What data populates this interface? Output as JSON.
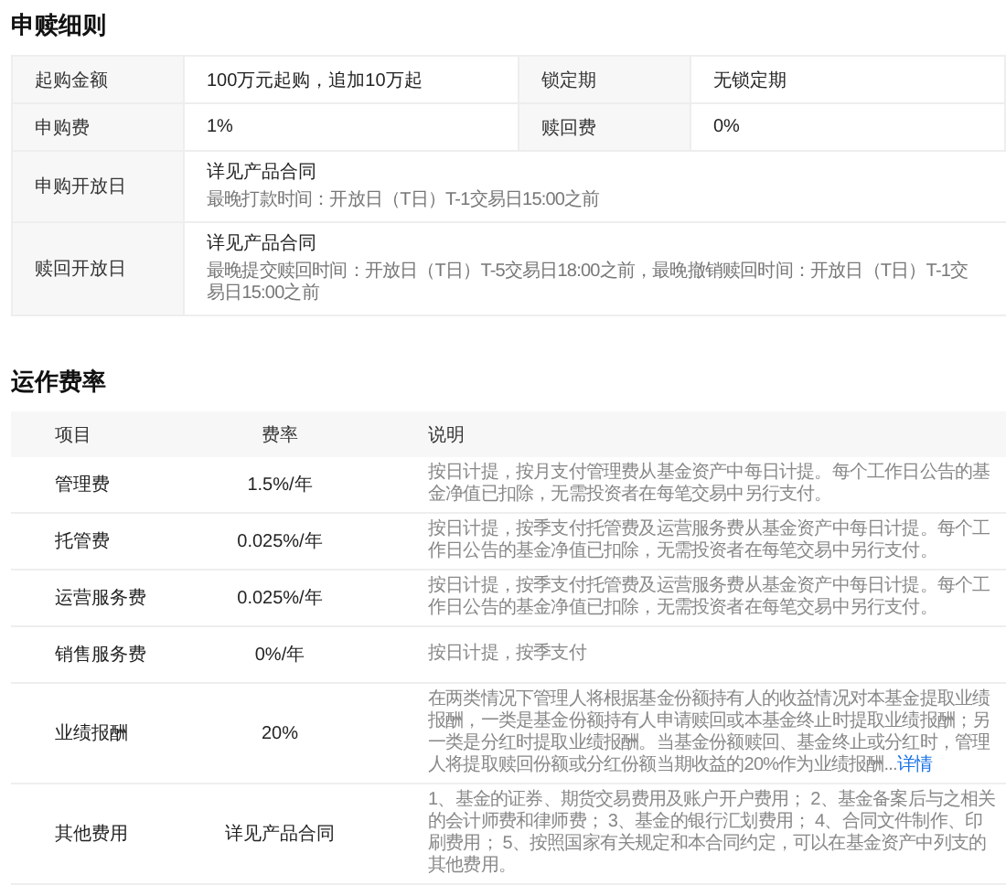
{
  "subscription": {
    "title": "申赎细则",
    "pair_rows": [
      {
        "label": "起购金额",
        "value": "100万元起购，追加10万起",
        "label_2": "锁定期",
        "value_2": "无锁定期"
      },
      {
        "label": "申购费",
        "value": "1%",
        "label_2": "赎回费",
        "value_2": "0%"
      }
    ],
    "wide_rows": [
      {
        "label": "申购开放日",
        "value": "详见产品合同",
        "note": "最晚打款时间：开放日（T日）T-1交易日15:00之前"
      },
      {
        "label": "赎回开放日",
        "value": "详见产品合同",
        "note": "最晚提交赎回时间：开放日（T日）T-5交易日18:00之前，最晚撤销赎回时间：开放日（T日）T-1交易日15:00之前"
      }
    ]
  },
  "fees": {
    "title": "运作费率",
    "columns": [
      "项目",
      "费率",
      "说明"
    ],
    "rows": [
      {
        "item": "管理费",
        "rate": "1.5%/年",
        "description": "按日计提，按月支付管理费从基金资产中每日计提。每个工作日公告的基金净值已扣除，无需投资者在每笔交易中另行支付。"
      },
      {
        "item": "托管费",
        "rate": "0.025%/年",
        "description": "按日计提，按季支付托管费及运营服务费从基金资产中每日计提。每个工作日公告的基金净值已扣除，无需投资者在每笔交易中另行支付。"
      },
      {
        "item": "运营服务费",
        "rate": "0.025%/年",
        "description": "按日计提，按季支付托管费及运营服务费从基金资产中每日计提。每个工作日公告的基金净值已扣除，无需投资者在每笔交易中另行支付。"
      },
      {
        "item": "销售服务费",
        "rate": "0%/年",
        "description": "按日计提，按季支付"
      },
      {
        "item": "业绩报酬",
        "rate": "20%",
        "description": "在两类情况下管理人将根据基金份额持有人的收益情况对本基金提取业绩报酬，一类是基金份额持有人申请赎回或本基金终止时提取业绩报酬；另一类是分红时提取业绩报酬。当基金份额赎回、基金终止或分红时，管理人将提取赎回份额或分红份额当期收益的20%作为业绩报酬...",
        "link": "详情"
      },
      {
        "item": "其他费用",
        "rate": "详见产品合同",
        "description": "1、基金的证券、期货交易费用及账户开户费用； 2、基金备案后与之相关的会计师费和律师费； 3、基金的银行汇划费用； 4、合同文件制作、印刷费用； 5、按照国家有关规定和本合同约定，可以在基金资产中列支的其他费用。"
      }
    ]
  }
}
